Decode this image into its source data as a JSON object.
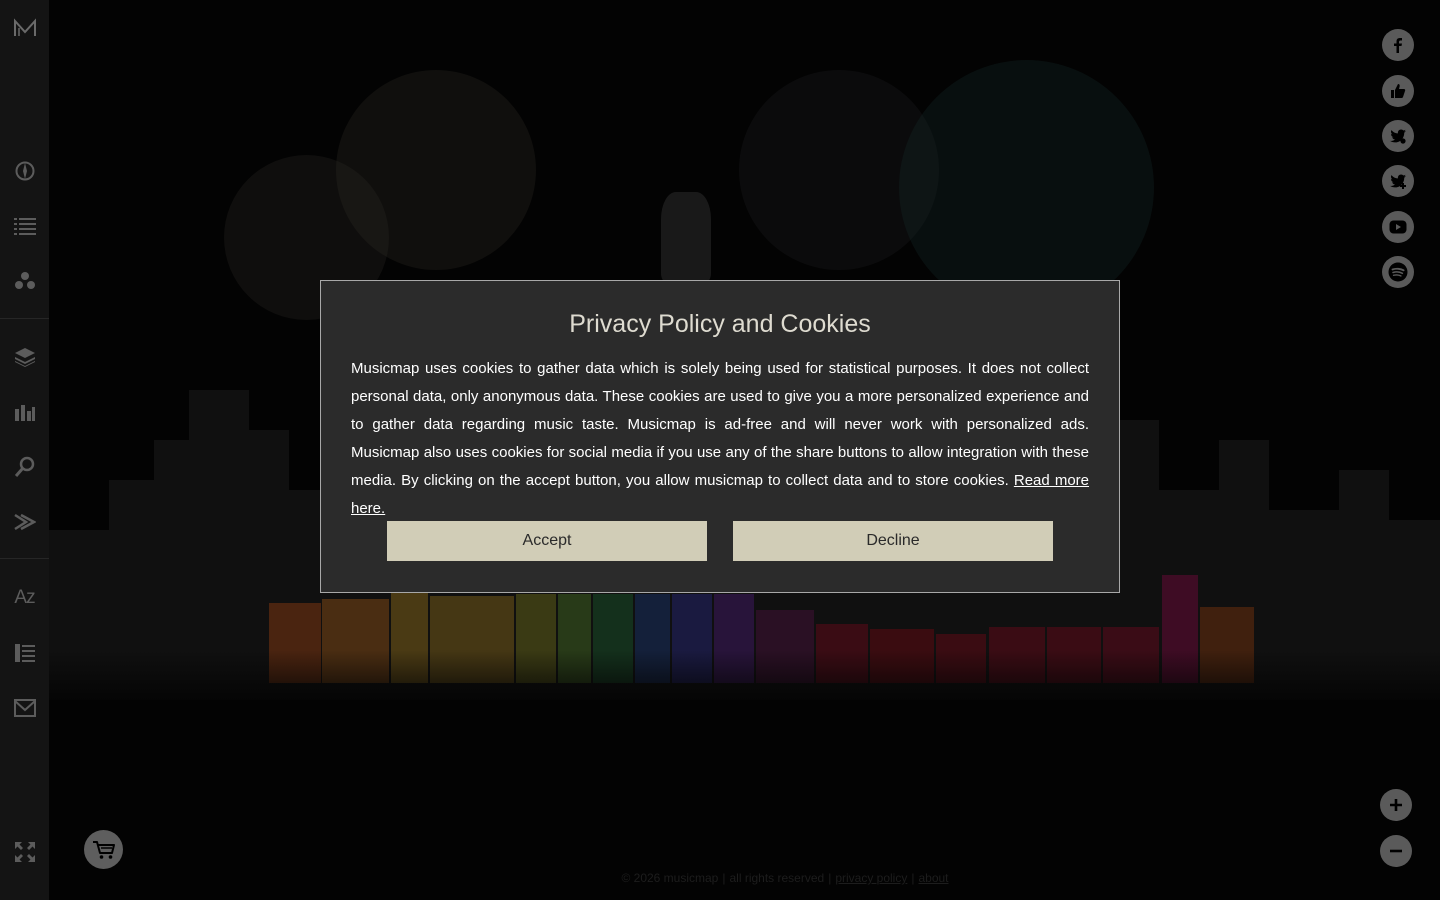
{
  "sidebar": {
    "logo_icon": "musicmap-logo-icon",
    "items": [
      {
        "name": "compass-icon"
      },
      {
        "name": "list-icon"
      },
      {
        "name": "network-icon"
      },
      {
        "name": "layers-icon"
      },
      {
        "name": "bar-chart-icon"
      },
      {
        "name": "search-icon"
      },
      {
        "name": "forward-arrow-icon"
      },
      {
        "name": "alphabetical-icon",
        "label": "Az"
      },
      {
        "name": "index-list-icon"
      },
      {
        "name": "mail-icon"
      },
      {
        "name": "fullscreen-icon"
      }
    ]
  },
  "social": [
    {
      "name": "facebook-icon"
    },
    {
      "name": "thumbs-up-icon"
    },
    {
      "name": "twitter-share-icon"
    },
    {
      "name": "twitter-follow-icon"
    },
    {
      "name": "youtube-icon"
    },
    {
      "name": "spotify-icon"
    }
  ],
  "zoom": {
    "in_icon": "plus-icon",
    "out_icon": "minus-icon"
  },
  "cart_icon": "cart-icon",
  "modal": {
    "title": "Privacy Policy and Cookies",
    "body": "Musicmap uses cookies to gather data which is solely being used for statistical purposes. It does not collect personal data, only anonymous data. These cookies are used to give you a more personalized experience and to gather data regarding music taste. Musicmap is ad-free and will never work with personalized ads. Musicmap also uses cookies for social media if you use any of the share buttons to allow integration with these media. By clicking on the accept button, you allow musicmap to collect data and to store cookies.",
    "read_more": "Read more here.",
    "accept_label": "Accept",
    "decline_label": "Decline"
  },
  "footer": {
    "copyright": "© 2026 musicmap",
    "rights": "all rights reserved",
    "privacy_link": "privacy policy",
    "about_link": "about",
    "separator": "|"
  },
  "colors": {
    "sidebar_bg": "#141414",
    "icon": "#5c5c5c",
    "modal_bg": "#2b2b2b",
    "button_bg": "#d1cdb7",
    "title": "#dedbd0"
  }
}
